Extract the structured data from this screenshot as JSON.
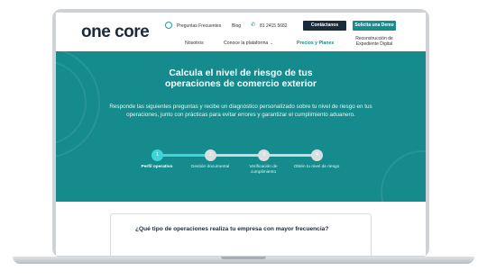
{
  "header": {
    "logo_one": "one",
    "logo_core": "core",
    "top_links": [
      "Preguntas Frecuentes",
      "Blog"
    ],
    "phone": "81 2415 5682",
    "contact_button": "Contáctanos",
    "demo_button": "Solicita una Demo",
    "nav": {
      "nosotros": "Nosotros",
      "plataforma": "Conoce la plataforma",
      "precios": "Precios y Planes",
      "reconstruccion": "Reconstrucción de Expediente Digital"
    }
  },
  "hero": {
    "title": "Calcula el nivel de riesgo de tus operaciones de comercio exterior",
    "description": "Responde las siguientes preguntas y recibe un diagnóstico personalizado sobre tu nivel de riesgo en tus operaciones, junto con prácticas para evitar errores y garantizar el cumplimiento aduanero.",
    "steps": [
      {
        "number": "1",
        "label": "Perfil operativo",
        "active": true
      },
      {
        "number": "2",
        "label": "Gestión documental",
        "active": false
      },
      {
        "number": "3",
        "label": "Verificación de cumplimiento",
        "active": false
      },
      {
        "number": "4",
        "label": "Obtén tu nivel de riesgo",
        "active": false
      }
    ],
    "progress": 0.33
  },
  "question_card": {
    "question": "¿Qué tipo de operaciones realiza tu empresa con mayor frecuencia?"
  },
  "colors": {
    "brand_teal": "#168b8d",
    "accent_cyan": "#3fd6d8",
    "navy": "#1a2b3b"
  },
  "icons": [
    "phone-icon",
    "chevron-down-icon",
    "logo-ring-icon"
  ]
}
